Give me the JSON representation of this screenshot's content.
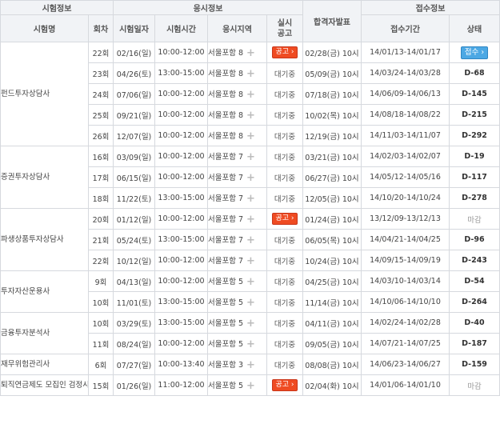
{
  "header": {
    "group_exam": "시험정보",
    "group_apply": "응시정보",
    "group_receipt": "접수정보",
    "col_name": "시험명",
    "col_round": "회차",
    "col_date": "시험일자",
    "col_time": "시험시간",
    "col_region": "응시지역",
    "col_notice": "실시\n공고",
    "col_result": "합격자발표",
    "col_period": "접수기간",
    "col_status": "상태"
  },
  "labels": {
    "notice_button": "공고 ›",
    "waiting": "대기중",
    "open_button": "접수 ›",
    "plus_icon": "+"
  },
  "exams": [
    {
      "name": "펀드투자상담사",
      "rounds": [
        {
          "round": "22회",
          "date": "02/16(일)",
          "time": "10:00-12:00",
          "region": "서울포함 8",
          "notice": "button",
          "result": "02/28(금) 10시",
          "period": "14/01/13-14/01/17",
          "status": "open",
          "status_text": "접수 ›"
        },
        {
          "round": "23회",
          "date": "04/26(토)",
          "time": "13:00-15:00",
          "region": "서울포함 8",
          "notice": "wait",
          "result": "05/09(금) 10시",
          "period": "14/03/24-14/03/28",
          "status": "dday",
          "status_text": "D-68"
        },
        {
          "round": "24회",
          "date": "07/06(일)",
          "time": "10:00-12:00",
          "region": "서울포함 8",
          "notice": "wait",
          "result": "07/18(금) 10시",
          "period": "14/06/09-14/06/13",
          "status": "dday",
          "status_text": "D-145"
        },
        {
          "round": "25회",
          "date": "09/21(일)",
          "time": "10:00-12:00",
          "region": "서울포함 8",
          "notice": "wait",
          "result": "10/02(목) 10시",
          "period": "14/08/18-14/08/22",
          "status": "dday",
          "status_text": "D-215"
        },
        {
          "round": "26회",
          "date": "12/07(일)",
          "time": "10:00-12:00",
          "region": "서울포함 8",
          "notice": "wait",
          "result": "12/19(금) 10시",
          "period": "14/11/03-14/11/07",
          "status": "dday",
          "status_text": "D-292"
        }
      ]
    },
    {
      "name": "증권투자상담사",
      "rounds": [
        {
          "round": "16회",
          "date": "03/09(일)",
          "time": "10:00-12:00",
          "region": "서울포함 7",
          "notice": "wait",
          "result": "03/21(금) 10시",
          "period": "14/02/03-14/02/07",
          "status": "dday",
          "status_text": "D-19"
        },
        {
          "round": "17회",
          "date": "06/15(일)",
          "time": "10:00-12:00",
          "region": "서울포함 7",
          "notice": "wait",
          "result": "06/27(금) 10시",
          "period": "14/05/12-14/05/16",
          "status": "dday",
          "status_text": "D-117"
        },
        {
          "round": "18회",
          "date": "11/22(토)",
          "time": "13:00-15:00",
          "region": "서울포함 7",
          "notice": "wait",
          "result": "12/05(금) 10시",
          "period": "14/10/20-14/10/24",
          "status": "dday",
          "status_text": "D-278"
        }
      ]
    },
    {
      "name": "파생상품투자상담사",
      "rounds": [
        {
          "round": "20회",
          "date": "01/12(일)",
          "time": "10:00-12:00",
          "region": "서울포함 7",
          "notice": "button",
          "result": "01/24(금) 10시",
          "period": "13/12/09-13/12/13",
          "status": "closed",
          "status_text": "마감"
        },
        {
          "round": "21회",
          "date": "05/24(토)",
          "time": "13:00-15:00",
          "region": "서울포함 7",
          "notice": "wait",
          "result": "06/05(목) 10시",
          "period": "14/04/21-14/04/25",
          "status": "dday",
          "status_text": "D-96"
        },
        {
          "round": "22회",
          "date": "10/12(일)",
          "time": "10:00-12:00",
          "region": "서울포함 7",
          "notice": "wait",
          "result": "10/24(금) 10시",
          "period": "14/09/15-14/09/19",
          "status": "dday",
          "status_text": "D-243"
        }
      ]
    },
    {
      "name": "투자자산운용사",
      "rounds": [
        {
          "round": "9회",
          "date": "04/13(일)",
          "time": "10:00-12:00",
          "region": "서울포함 5",
          "notice": "wait",
          "result": "04/25(금) 10시",
          "period": "14/03/10-14/03/14",
          "status": "dday",
          "status_text": "D-54"
        },
        {
          "round": "10회",
          "date": "11/01(토)",
          "time": "13:00-15:00",
          "region": "서울포함 5",
          "notice": "wait",
          "result": "11/14(금) 10시",
          "period": "14/10/06-14/10/10",
          "status": "dday",
          "status_text": "D-264"
        }
      ]
    },
    {
      "name": "금융투자분석사",
      "rounds": [
        {
          "round": "10회",
          "date": "03/29(토)",
          "time": "13:00-15:00",
          "region": "서울포함 5",
          "notice": "wait",
          "result": "04/11(금) 10시",
          "period": "14/02/24-14/02/28",
          "status": "dday",
          "status_text": "D-40"
        },
        {
          "round": "11회",
          "date": "08/24(일)",
          "time": "10:00-12:00",
          "region": "서울포함 5",
          "notice": "wait",
          "result": "09/05(금) 10시",
          "period": "14/07/21-14/07/25",
          "status": "dday",
          "status_text": "D-187"
        }
      ]
    },
    {
      "name": "재무위험관리사",
      "rounds": [
        {
          "round": "6회",
          "date": "07/27(일)",
          "time": "10:00-13:40",
          "region": "서울포함 3",
          "notice": "wait",
          "result": "08/08(금) 10시",
          "period": "14/06/23-14/06/27",
          "status": "dday",
          "status_text": "D-159"
        }
      ]
    },
    {
      "name": "퇴직연금제도 모집인 검정시험",
      "rounds": [
        {
          "round": "15회",
          "date": "01/26(일)",
          "time": "11:00-12:00",
          "region": "서울포함 5",
          "notice": "button",
          "result": "02/04(화) 10시",
          "period": "14/01/06-14/01/10",
          "status": "closed",
          "status_text": "마감"
        }
      ]
    }
  ]
}
